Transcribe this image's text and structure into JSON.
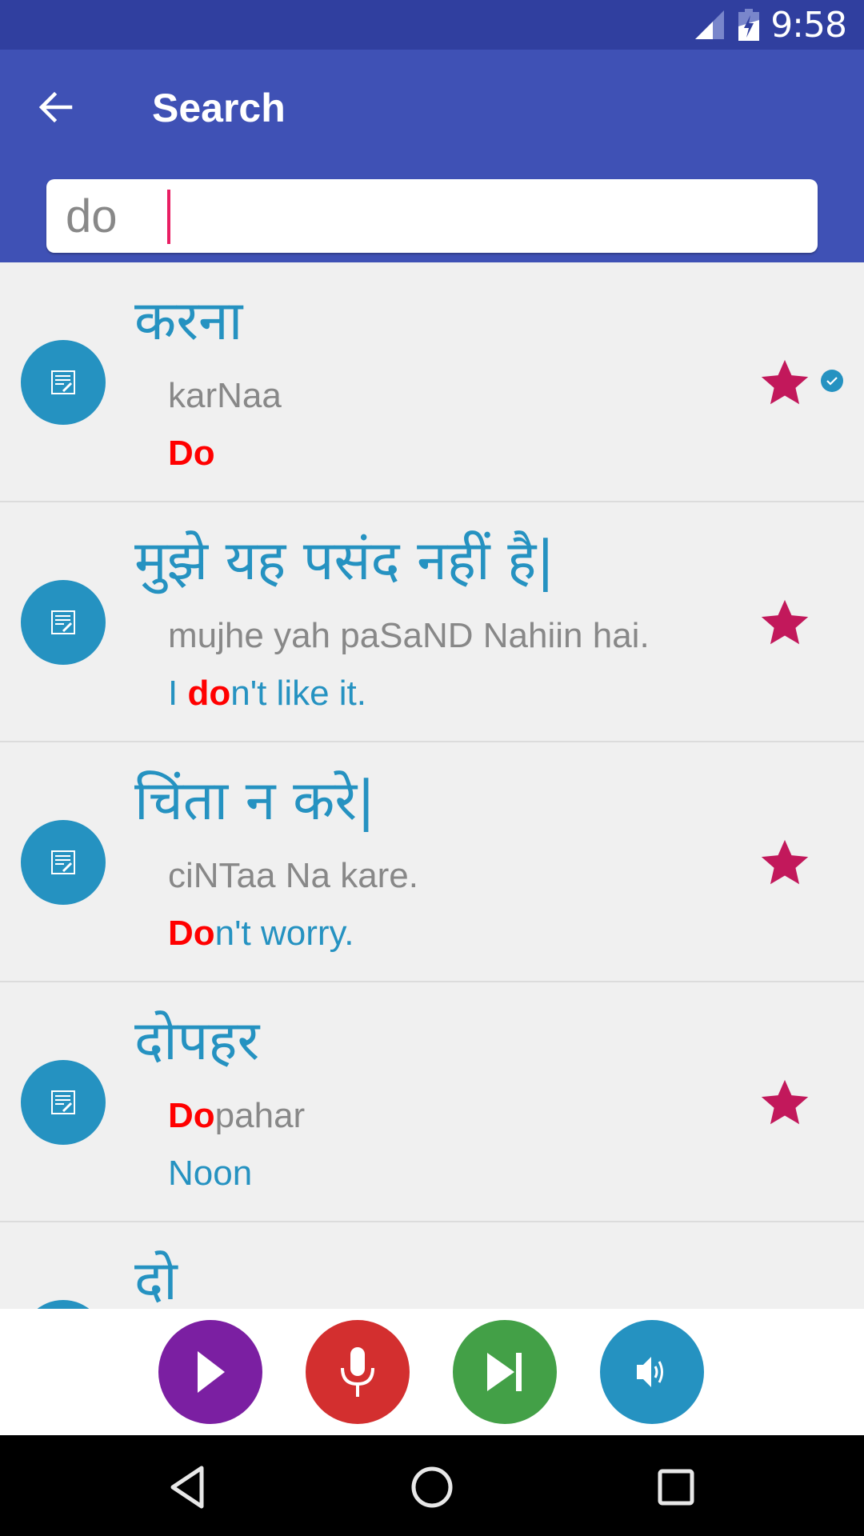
{
  "status_bar": {
    "time": "9:58",
    "signal_icon": "cell-signal-icon",
    "battery_icon": "battery-charging-icon"
  },
  "app_bar": {
    "title": "Search",
    "back_icon": "arrow-back-icon"
  },
  "search": {
    "value": "do",
    "placeholder": ""
  },
  "colors": {
    "primary": "#3f51b5",
    "primary_dark": "#303f9f",
    "accent_text": "#2592c1",
    "highlight": "#ff0000",
    "star": "#c2185b",
    "play": "#7b1fa2",
    "mic": "#d32f2f",
    "next": "#43a047",
    "speaker": "#2592c1"
  },
  "results": [
    {
      "hindi": "करना",
      "translit_pre": "",
      "translit_hl": "",
      "translit_post": "karNaa",
      "english_pre": "",
      "english_hl": "Do",
      "english_post": "",
      "starred": true,
      "checked": true
    },
    {
      "hindi": "मुझे यह पसंद नहीं है|",
      "translit_pre": "",
      "translit_hl": "",
      "translit_post": "mujhe yah paSaND Nahiin hai.",
      "english_pre": "I ",
      "english_hl": "do",
      "english_post": "n't like it.",
      "starred": true,
      "checked": false
    },
    {
      "hindi": "चिंता न करे|",
      "translit_pre": "",
      "translit_hl": "",
      "translit_post": "ciNTaa Na kare.",
      "english_pre": "",
      "english_hl": "Do",
      "english_post": "n't worry.",
      "starred": true,
      "checked": false
    },
    {
      "hindi": "दोपहर",
      "translit_pre": "",
      "translit_hl": "Do",
      "translit_post": "pahar",
      "english_pre": "Noon",
      "english_hl": "",
      "english_post": "",
      "starred": true,
      "checked": false
    },
    {
      "hindi": "दो",
      "translit_pre": "",
      "translit_hl": "",
      "translit_post": "",
      "english_pre": "",
      "english_hl": "",
      "english_post": "",
      "starred": false,
      "checked": false
    }
  ],
  "controls": [
    {
      "name": "play-button",
      "icon": "play-icon"
    },
    {
      "name": "microphone-button",
      "icon": "microphone-icon"
    },
    {
      "name": "skip-next-button",
      "icon": "skip-next-icon"
    },
    {
      "name": "speaker-button",
      "icon": "volume-icon"
    }
  ],
  "nav": [
    {
      "icon": "nav-back-icon"
    },
    {
      "icon": "nav-home-icon"
    },
    {
      "icon": "nav-recents-icon"
    }
  ]
}
